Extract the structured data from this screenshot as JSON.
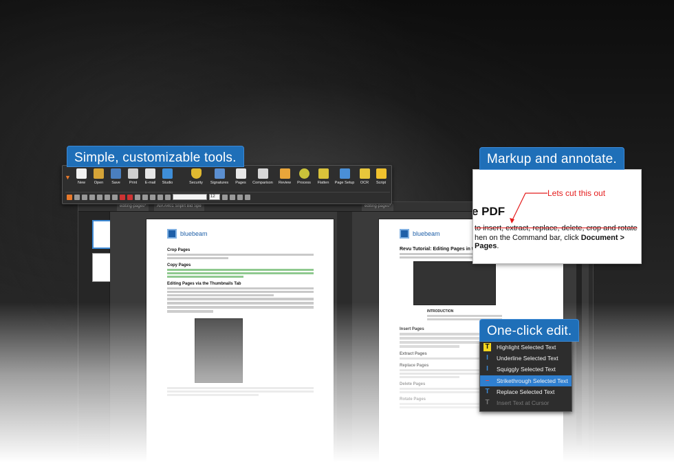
{
  "callouts": {
    "tools": "Simple, customizable tools.",
    "markup": "Markup and annotate.",
    "edit": "One-click edit."
  },
  "toolbar": {
    "tools": [
      {
        "label": "New",
        "icon": "new-file-icon"
      },
      {
        "label": "Open",
        "icon": "open-folder-icon"
      },
      {
        "label": "Save",
        "icon": "save-icon"
      },
      {
        "label": "Print",
        "icon": "print-icon"
      },
      {
        "label": "E-mail",
        "icon": "email-icon"
      },
      {
        "label": "Studio",
        "icon": "studio-icon"
      },
      {
        "label": "Security",
        "icon": "security-shield-icon"
      },
      {
        "label": "Signatures",
        "icon": "signature-icon"
      },
      {
        "label": "Pages",
        "icon": "pages-icon"
      },
      {
        "label": "Comparison",
        "icon": "comparison-icon"
      },
      {
        "label": "Review",
        "icon": "review-icon"
      },
      {
        "label": "Process",
        "icon": "process-gear-icon"
      },
      {
        "label": "Flatten",
        "icon": "flatten-icon"
      },
      {
        "label": "Page Setup",
        "icon": "page-setup-icon"
      },
      {
        "label": "OCR",
        "icon": "ocr-icon"
      },
      {
        "label": "Script",
        "icon": "script-icon"
      }
    ],
    "font_size": "12"
  },
  "doc_tabs": [
    "editing-pages*",
    "AIA A401 Snplrt Bid Spe",
    "editing-pages*"
  ],
  "left_page": {
    "brand": "bluebeam",
    "h_crop": "Crop Pages",
    "h_copy": "Copy Pages",
    "h_thumbs": "Editing Pages via the Thumbnails Tab"
  },
  "right_page": {
    "brand": "bluebeam",
    "title": "Revu Tutorial: Editing Pages in the",
    "h_insert": "Insert Pages",
    "h_extract": "Extract Pages",
    "h_replace": "Replace Pages",
    "h_delete": "Delete Pages",
    "h_rotate": "Rotate Pages",
    "intro": "INTRODUCTION"
  },
  "markup": {
    "note": "Lets cut this out",
    "heading": "e PDF",
    "struck": "to insert, extract, replace, delete, crop and rotate",
    "line2_pre": "hen on the Command bar, click ",
    "line2_bold": "Document > Pages",
    "line2_post": "."
  },
  "edit_menu": {
    "items": [
      {
        "label": "Highlight Selected Text",
        "icon": "highlight-icon"
      },
      {
        "label": "Underline Selected Text",
        "icon": "underline-icon"
      },
      {
        "label": "Squiggly Selected Text",
        "icon": "squiggly-icon"
      },
      {
        "label": "Strikethrough Selected Text",
        "icon": "strikethrough-icon"
      },
      {
        "label": "Replace Selected Text",
        "icon": "replace-text-icon"
      },
      {
        "label": "Insert Text at Cursor",
        "icon": "insert-text-icon"
      }
    ],
    "active_index": 3,
    "disabled_index": 5
  },
  "colors": {
    "accent": "#1f6fb8",
    "highlight": "#f3f33a",
    "menu_active": "#2f7fd0",
    "annotation": "#e41c1c"
  }
}
